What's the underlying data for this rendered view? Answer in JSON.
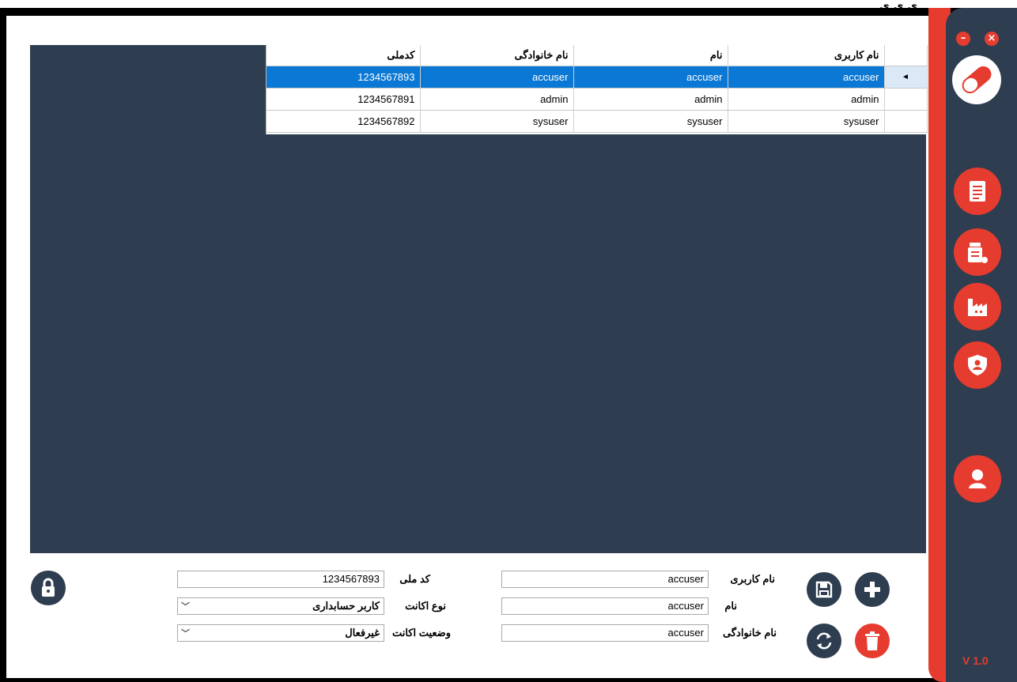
{
  "top_fragment": "ى ى ى",
  "colors": {
    "accent": "#e63c2f",
    "panel": "#2e3e50",
    "selection": "#0a78d4"
  },
  "grid": {
    "columns": [
      "نام کاربری",
      "نام",
      "نام خانوادگی",
      "کدملی"
    ],
    "rows": [
      {
        "username": "accuser",
        "first": "accuser",
        "last": "accuser",
        "code": "1234567893",
        "selected": true,
        "indicator": "◄"
      },
      {
        "username": "admin",
        "first": "admin",
        "last": "admin",
        "code": "1234567891",
        "selected": false,
        "indicator": ""
      },
      {
        "username": "sysuser",
        "first": "sysuser",
        "last": "sysuser",
        "code": "1234567892",
        "selected": false,
        "indicator": ""
      }
    ]
  },
  "form": {
    "username_label": "نام کاربری",
    "username_value": "accuser",
    "first_label": "نام",
    "first_value": "accuser",
    "last_label": "نام خانوادگی",
    "last_value": "accuser",
    "code_label": "کد ملی",
    "code_value": "1234567893",
    "type_label": "نوع اکانت",
    "type_value": "کاربر حسابداری",
    "status_label": "وضعیت اکانت",
    "status_value": "غیرفعال"
  },
  "sidebar": {
    "icons": [
      "clipboard-icon",
      "medicine-icon",
      "factory-icon",
      "shield-user-icon",
      "user-icon"
    ],
    "version": "V 1.0"
  }
}
